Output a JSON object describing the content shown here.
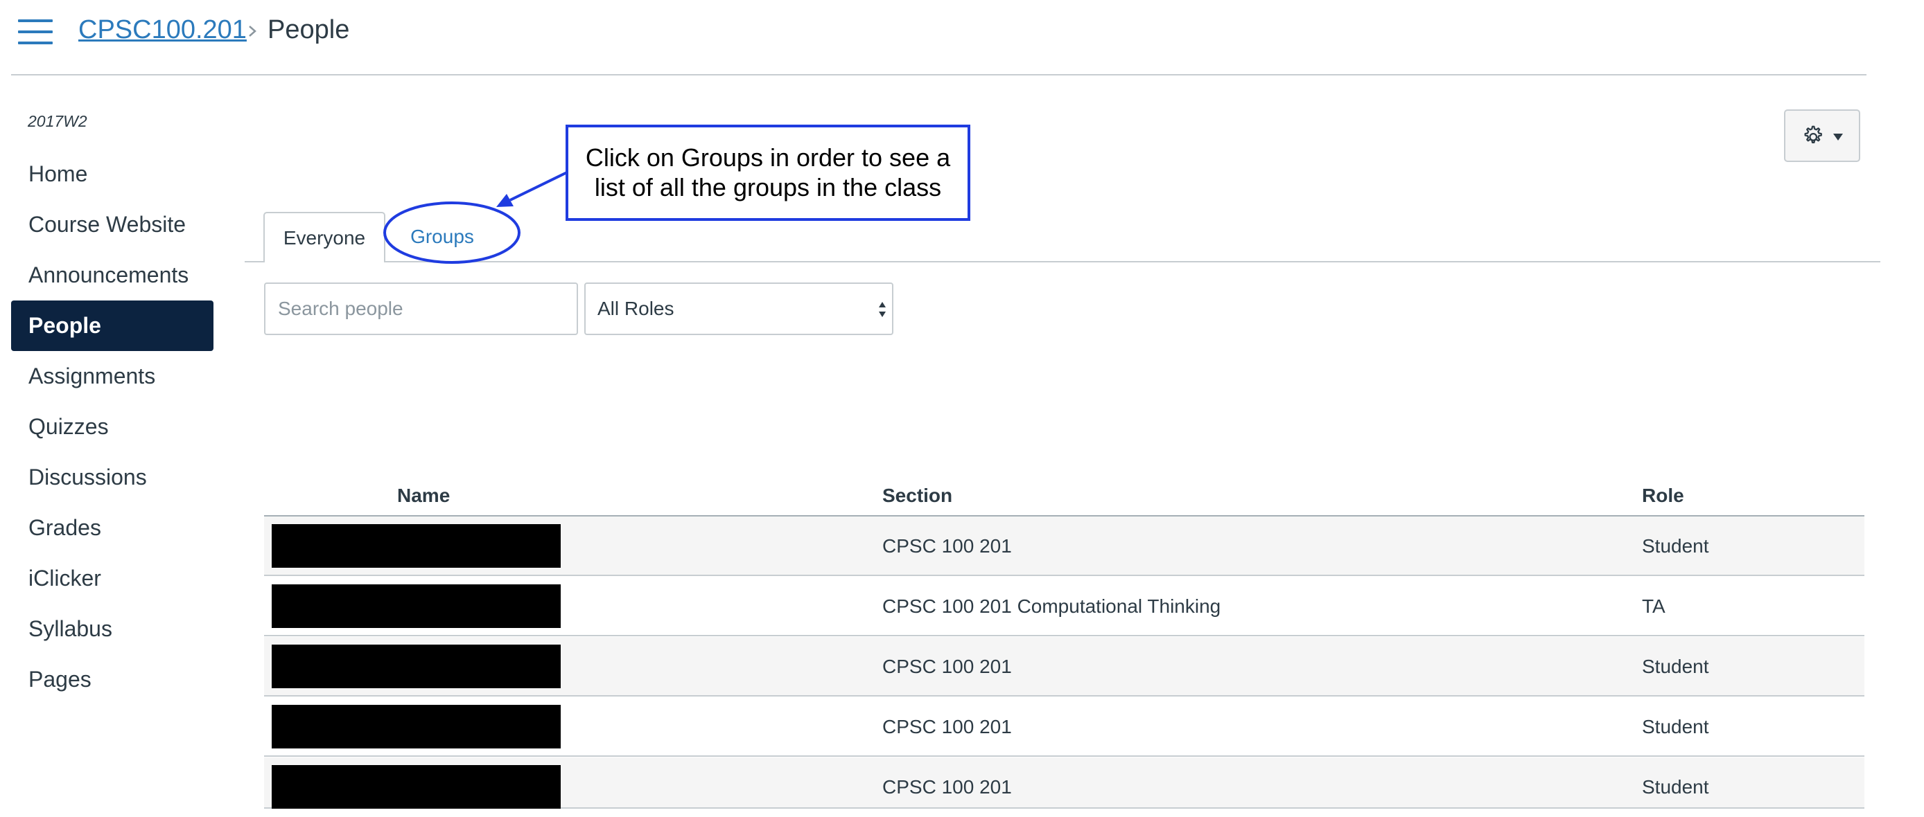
{
  "header": {
    "menu_icon": "hamburger-icon",
    "breadcrumb": {
      "course": "CPSC100.201",
      "current": "People"
    }
  },
  "sidebar": {
    "term": "2017W2",
    "items": [
      {
        "label": "Home"
      },
      {
        "label": "Course Website"
      },
      {
        "label": "Announcements"
      },
      {
        "label": "People",
        "active": true
      },
      {
        "label": "Assignments"
      },
      {
        "label": "Quizzes"
      },
      {
        "label": "Discussions"
      },
      {
        "label": "Grades"
      },
      {
        "label": "iClicker"
      },
      {
        "label": "Syllabus"
      },
      {
        "label": "Pages"
      }
    ]
  },
  "toolbar": {
    "settings_icon": "gear-icon",
    "caret_icon": "caret-down-icon"
  },
  "tabs": [
    {
      "label": "Everyone",
      "selected": true
    },
    {
      "label": "Groups"
    }
  ],
  "callout": {
    "line1": "Click on Groups in order to see a",
    "line2": "list of all the groups in the class"
  },
  "filters": {
    "search_placeholder": "Search people",
    "role_value": "All Roles"
  },
  "table": {
    "columns": [
      "Name",
      "Section",
      "Role"
    ],
    "rows": [
      {
        "name": "",
        "section": "CPSC 100 201",
        "role": "Student"
      },
      {
        "name": "",
        "section": "CPSC 100 201 Computational Thinking",
        "role": "TA"
      },
      {
        "name": "",
        "section": "CPSC 100 201",
        "role": "Student"
      },
      {
        "name": "",
        "section": "CPSC 100 201",
        "role": "Student"
      },
      {
        "name": "",
        "section": "CPSC 100 201",
        "role": "Student"
      }
    ]
  },
  "colors": {
    "link": "#2b7abc",
    "nav_active_bg": "#0c2340",
    "annotation": "#1f3ce0",
    "row_stripe": "#f5f5f5"
  }
}
